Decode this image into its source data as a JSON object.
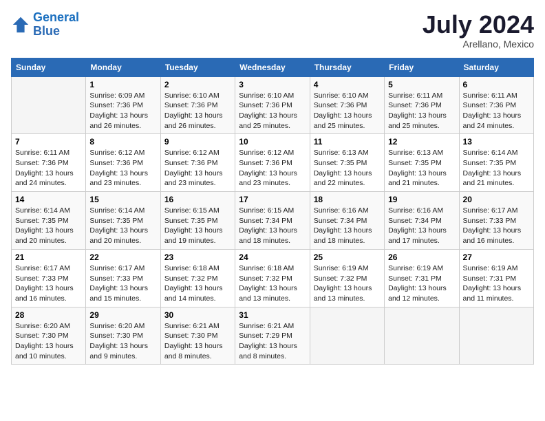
{
  "header": {
    "logo_line1": "General",
    "logo_line2": "Blue",
    "month_title": "July 2024",
    "location": "Arellano, Mexico"
  },
  "columns": [
    "Sunday",
    "Monday",
    "Tuesday",
    "Wednesday",
    "Thursday",
    "Friday",
    "Saturday"
  ],
  "weeks": [
    [
      {
        "day": "",
        "sunrise": "",
        "sunset": "",
        "daylight": ""
      },
      {
        "day": "1",
        "sunrise": "Sunrise: 6:09 AM",
        "sunset": "Sunset: 7:36 PM",
        "daylight": "Daylight: 13 hours and 26 minutes."
      },
      {
        "day": "2",
        "sunrise": "Sunrise: 6:10 AM",
        "sunset": "Sunset: 7:36 PM",
        "daylight": "Daylight: 13 hours and 26 minutes."
      },
      {
        "day": "3",
        "sunrise": "Sunrise: 6:10 AM",
        "sunset": "Sunset: 7:36 PM",
        "daylight": "Daylight: 13 hours and 25 minutes."
      },
      {
        "day": "4",
        "sunrise": "Sunrise: 6:10 AM",
        "sunset": "Sunset: 7:36 PM",
        "daylight": "Daylight: 13 hours and 25 minutes."
      },
      {
        "day": "5",
        "sunrise": "Sunrise: 6:11 AM",
        "sunset": "Sunset: 7:36 PM",
        "daylight": "Daylight: 13 hours and 25 minutes."
      },
      {
        "day": "6",
        "sunrise": "Sunrise: 6:11 AM",
        "sunset": "Sunset: 7:36 PM",
        "daylight": "Daylight: 13 hours and 24 minutes."
      }
    ],
    [
      {
        "day": "7",
        "sunrise": "Sunrise: 6:11 AM",
        "sunset": "Sunset: 7:36 PM",
        "daylight": "Daylight: 13 hours and 24 minutes."
      },
      {
        "day": "8",
        "sunrise": "Sunrise: 6:12 AM",
        "sunset": "Sunset: 7:36 PM",
        "daylight": "Daylight: 13 hours and 23 minutes."
      },
      {
        "day": "9",
        "sunrise": "Sunrise: 6:12 AM",
        "sunset": "Sunset: 7:36 PM",
        "daylight": "Daylight: 13 hours and 23 minutes."
      },
      {
        "day": "10",
        "sunrise": "Sunrise: 6:12 AM",
        "sunset": "Sunset: 7:36 PM",
        "daylight": "Daylight: 13 hours and 23 minutes."
      },
      {
        "day": "11",
        "sunrise": "Sunrise: 6:13 AM",
        "sunset": "Sunset: 7:35 PM",
        "daylight": "Daylight: 13 hours and 22 minutes."
      },
      {
        "day": "12",
        "sunrise": "Sunrise: 6:13 AM",
        "sunset": "Sunset: 7:35 PM",
        "daylight": "Daylight: 13 hours and 21 minutes."
      },
      {
        "day": "13",
        "sunrise": "Sunrise: 6:14 AM",
        "sunset": "Sunset: 7:35 PM",
        "daylight": "Daylight: 13 hours and 21 minutes."
      }
    ],
    [
      {
        "day": "14",
        "sunrise": "Sunrise: 6:14 AM",
        "sunset": "Sunset: 7:35 PM",
        "daylight": "Daylight: 13 hours and 20 minutes."
      },
      {
        "day": "15",
        "sunrise": "Sunrise: 6:14 AM",
        "sunset": "Sunset: 7:35 PM",
        "daylight": "Daylight: 13 hours and 20 minutes."
      },
      {
        "day": "16",
        "sunrise": "Sunrise: 6:15 AM",
        "sunset": "Sunset: 7:35 PM",
        "daylight": "Daylight: 13 hours and 19 minutes."
      },
      {
        "day": "17",
        "sunrise": "Sunrise: 6:15 AM",
        "sunset": "Sunset: 7:34 PM",
        "daylight": "Daylight: 13 hours and 18 minutes."
      },
      {
        "day": "18",
        "sunrise": "Sunrise: 6:16 AM",
        "sunset": "Sunset: 7:34 PM",
        "daylight": "Daylight: 13 hours and 18 minutes."
      },
      {
        "day": "19",
        "sunrise": "Sunrise: 6:16 AM",
        "sunset": "Sunset: 7:34 PM",
        "daylight": "Daylight: 13 hours and 17 minutes."
      },
      {
        "day": "20",
        "sunrise": "Sunrise: 6:17 AM",
        "sunset": "Sunset: 7:33 PM",
        "daylight": "Daylight: 13 hours and 16 minutes."
      }
    ],
    [
      {
        "day": "21",
        "sunrise": "Sunrise: 6:17 AM",
        "sunset": "Sunset: 7:33 PM",
        "daylight": "Daylight: 13 hours and 16 minutes."
      },
      {
        "day": "22",
        "sunrise": "Sunrise: 6:17 AM",
        "sunset": "Sunset: 7:33 PM",
        "daylight": "Daylight: 13 hours and 15 minutes."
      },
      {
        "day": "23",
        "sunrise": "Sunrise: 6:18 AM",
        "sunset": "Sunset: 7:32 PM",
        "daylight": "Daylight: 13 hours and 14 minutes."
      },
      {
        "day": "24",
        "sunrise": "Sunrise: 6:18 AM",
        "sunset": "Sunset: 7:32 PM",
        "daylight": "Daylight: 13 hours and 13 minutes."
      },
      {
        "day": "25",
        "sunrise": "Sunrise: 6:19 AM",
        "sunset": "Sunset: 7:32 PM",
        "daylight": "Daylight: 13 hours and 13 minutes."
      },
      {
        "day": "26",
        "sunrise": "Sunrise: 6:19 AM",
        "sunset": "Sunset: 7:31 PM",
        "daylight": "Daylight: 13 hours and 12 minutes."
      },
      {
        "day": "27",
        "sunrise": "Sunrise: 6:19 AM",
        "sunset": "Sunset: 7:31 PM",
        "daylight": "Daylight: 13 hours and 11 minutes."
      }
    ],
    [
      {
        "day": "28",
        "sunrise": "Sunrise: 6:20 AM",
        "sunset": "Sunset: 7:30 PM",
        "daylight": "Daylight: 13 hours and 10 minutes."
      },
      {
        "day": "29",
        "sunrise": "Sunrise: 6:20 AM",
        "sunset": "Sunset: 7:30 PM",
        "daylight": "Daylight: 13 hours and 9 minutes."
      },
      {
        "day": "30",
        "sunrise": "Sunrise: 6:21 AM",
        "sunset": "Sunset: 7:30 PM",
        "daylight": "Daylight: 13 hours and 8 minutes."
      },
      {
        "day": "31",
        "sunrise": "Sunrise: 6:21 AM",
        "sunset": "Sunset: 7:29 PM",
        "daylight": "Daylight: 13 hours and 8 minutes."
      },
      {
        "day": "",
        "sunrise": "",
        "sunset": "",
        "daylight": ""
      },
      {
        "day": "",
        "sunrise": "",
        "sunset": "",
        "daylight": ""
      },
      {
        "day": "",
        "sunrise": "",
        "sunset": "",
        "daylight": ""
      }
    ]
  ]
}
